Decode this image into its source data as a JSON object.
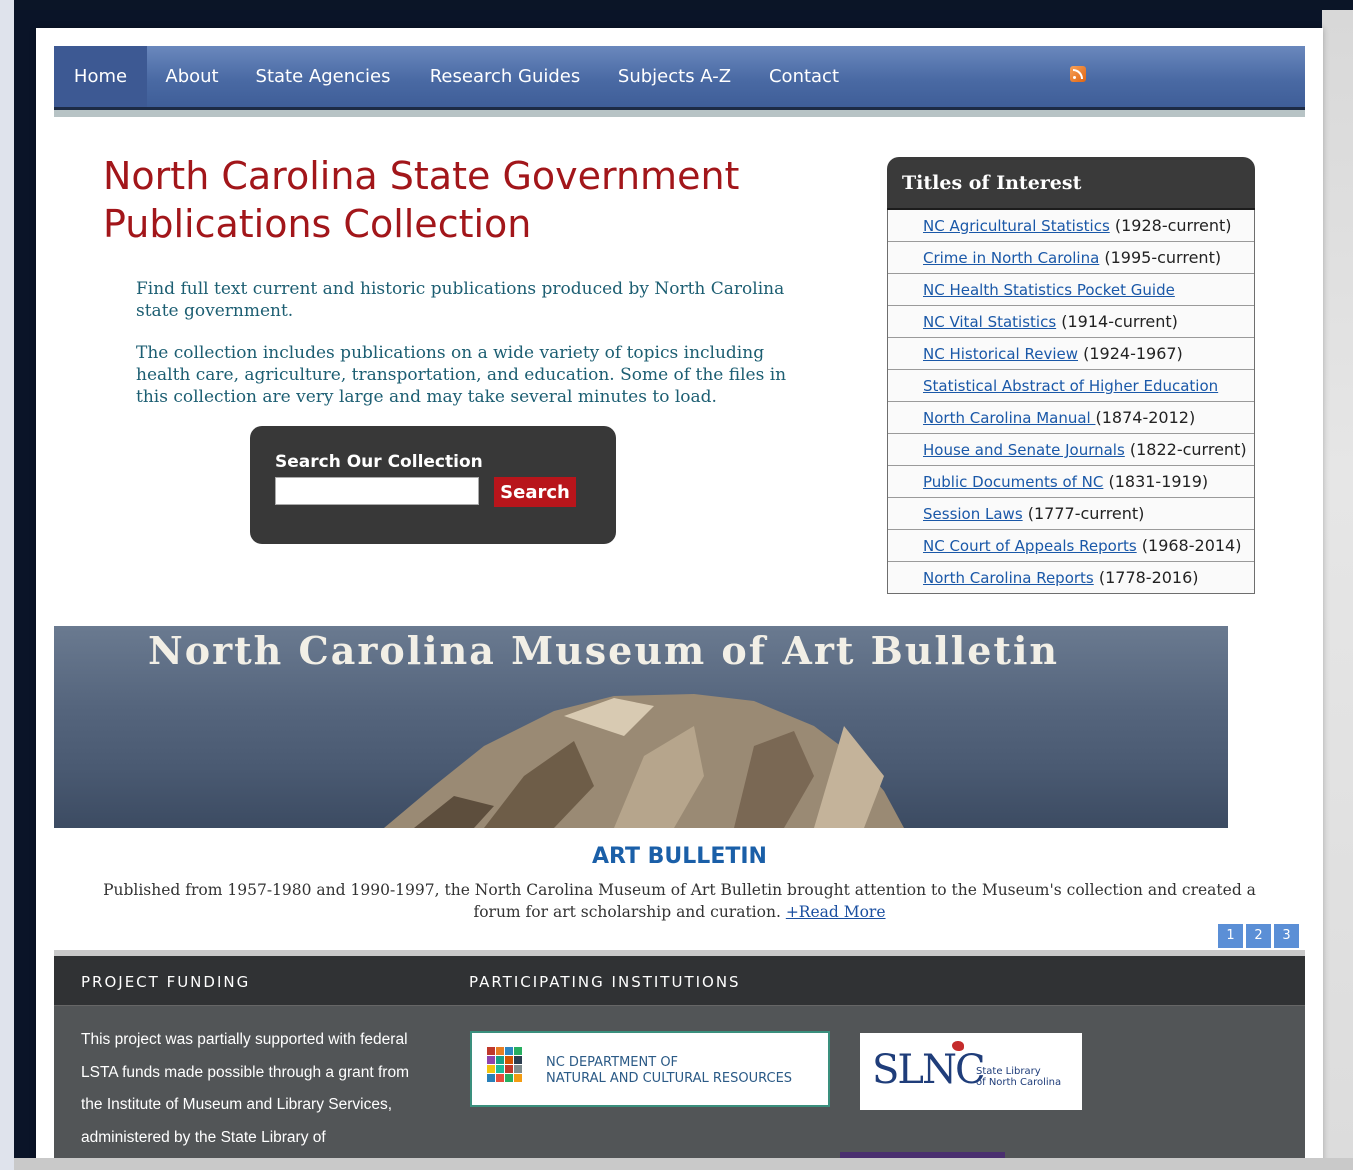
{
  "nav": {
    "items": [
      {
        "label": "Home",
        "active": true
      },
      {
        "label": "About"
      },
      {
        "label": "State Agencies"
      },
      {
        "label": "Research Guides"
      },
      {
        "label": "Subjects A-Z"
      },
      {
        "label": "Contact"
      }
    ],
    "rss_icon": "rss-icon"
  },
  "header": {
    "title": "North Carolina State Government Publications Collection"
  },
  "intro": {
    "p1": "Find full text current and historic publications produced by North Carolina state government.",
    "p2": "The collection includes publications on a wide variety of topics including health care, agriculture, transportation, and education. Some of the files in this collection are very large and may take several minutes to load."
  },
  "search": {
    "label": "Search Our Collection",
    "value": "",
    "placeholder": "",
    "button": "Search"
  },
  "titles_of_interest": {
    "heading": "Titles of Interest",
    "items": [
      {
        "link": "NC Agricultural Statistics",
        "years": " (1928-current)"
      },
      {
        "link": "Crime in North Carolina",
        "years": " (1995-current)"
      },
      {
        "link": "NC Health Statistics Pocket Guide",
        "years": ""
      },
      {
        "link": "NC Vital Statistics",
        "years": " (1914-current)"
      },
      {
        "link": "NC Historical Review",
        "years": " (1924-1967)"
      },
      {
        "link": "Statistical Abstract of Higher Education",
        "years": ""
      },
      {
        "link": "North Carolina Manual ",
        "years": "(1874-2012)"
      },
      {
        "link": "House and Senate Journals",
        "years": " (1822-current)"
      },
      {
        "link": "Public Documents of NC",
        "years": " (1831-1919)"
      },
      {
        "link": "Session Laws",
        "years": " (1777-current)"
      },
      {
        "link": "NC Court of Appeals Reports",
        "years": " (1968-2014)"
      },
      {
        "link": "North Carolina Reports",
        "years": " (1778-2016)"
      }
    ]
  },
  "feature": {
    "banner_title": "North Carolina Museum of Art Bulletin",
    "title": "ART BULLETIN",
    "text": "Published from 1957-1980 and 1990-1997, the North Carolina Museum of Art Bulletin brought attention to the Museum's collection and created a forum for art scholarship and curation. ",
    "read_more": "+Read More",
    "pages": [
      "1",
      "2",
      "3"
    ]
  },
  "footer": {
    "funding_heading": "PROJECT FUNDING",
    "funding_text": "This project was partially supported with federal LSTA funds made possible through a grant from the Institute of Museum and Library Services, administered by the State Library of",
    "institutions_heading": "PARTICIPATING INSTITUTIONS",
    "ncdnr_line1": "NC DEPARTMENT OF",
    "ncdnr_line2": "NATURAL AND CULTURAL RESOURCES",
    "slnc_logo": "SLNC",
    "slnc_sub1": "State Library",
    "slnc_sub2": "of North Carolina"
  },
  "colors": {
    "nav": "#4a6aa4",
    "title": "#a2161a",
    "intro_text": "#1c5e72",
    "search_button": "#b8151b",
    "link": "#1a58a8",
    "footer": "#525557"
  }
}
